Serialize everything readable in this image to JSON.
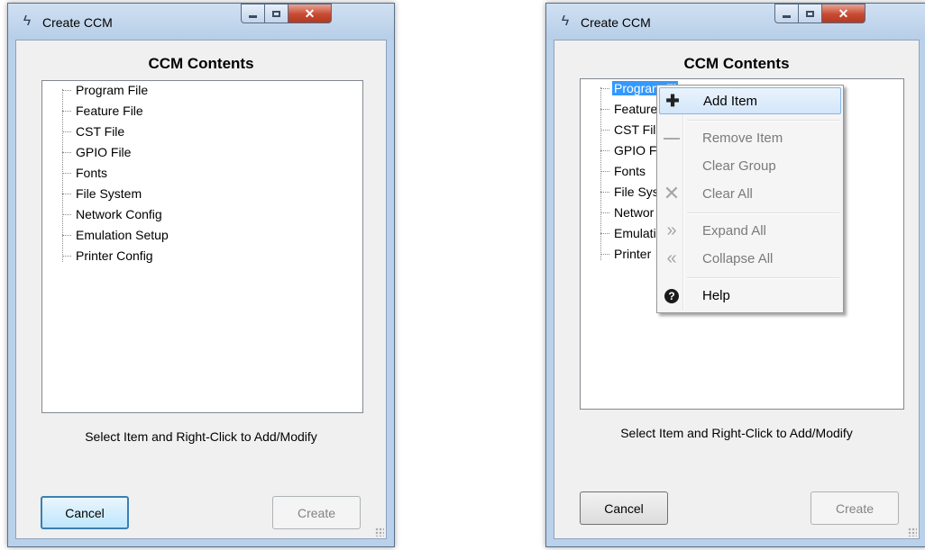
{
  "windows": [
    {
      "title": "Create CCM",
      "heading": "CCM Contents",
      "tree_items": [
        "Program File",
        "Feature File",
        "CST File",
        "GPIO File",
        "Fonts",
        "File System",
        "Network Config",
        "Emulation Setup",
        "Printer Config"
      ],
      "hint": "Select Item and Right-Click to Add/Modify",
      "cancel_label": "Cancel",
      "create_label": "Create"
    },
    {
      "title": "Create CCM",
      "heading": "CCM Contents",
      "tree_items": [
        "Program Fi",
        "Feature",
        "CST Fil",
        "GPIO F",
        "Fonts",
        "File Sys",
        "Networ",
        "Emulati",
        "Printer"
      ],
      "selected_index": 0,
      "hint": "Select Item and Right-Click to Add/Modify",
      "cancel_label": "Cancel",
      "create_label": "Create"
    }
  ],
  "context_menu": {
    "items": [
      {
        "label": "Add Item",
        "icon": "plus-icon",
        "enabled": true,
        "highlighted": true
      },
      {
        "label": "Remove Item",
        "icon": "minus-icon",
        "enabled": false
      },
      {
        "label": "Clear Group",
        "icon": "",
        "enabled": false
      },
      {
        "label": "Clear All",
        "icon": "x-icon",
        "enabled": false
      },
      {
        "label": "Expand All",
        "icon": "double-chevron-right-icon",
        "enabled": false
      },
      {
        "label": "Collapse All",
        "icon": "double-chevron-left-icon",
        "enabled": false
      },
      {
        "label": "Help",
        "icon": "help-icon",
        "enabled": true
      }
    ]
  },
  "colors": {
    "selection": "#3399ff",
    "menu_highlight": "#d3e6f9",
    "close_button": "#c74a32"
  }
}
